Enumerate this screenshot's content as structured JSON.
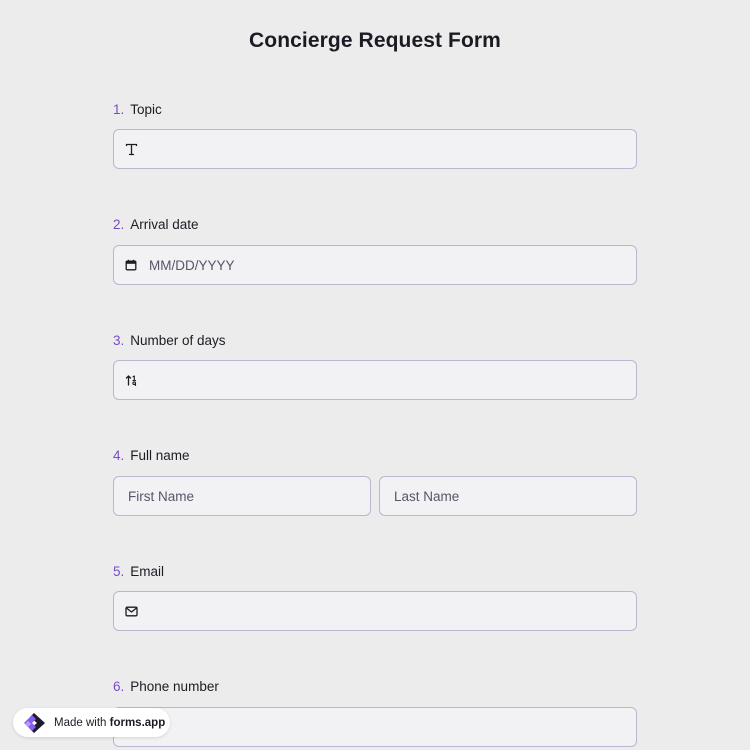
{
  "form": {
    "title": "Concierge Request Form"
  },
  "questions": [
    {
      "number": "1.",
      "label": "Topic",
      "icon": "text-icon",
      "value": "",
      "placeholder": ""
    },
    {
      "number": "2.",
      "label": "Arrival date",
      "icon": "calendar-icon",
      "value": "",
      "placeholder": "MM/DD/YYYY"
    },
    {
      "number": "3.",
      "label": "Number of days",
      "icon": "number-sort-icon",
      "value": "",
      "placeholder": ""
    },
    {
      "number": "4.",
      "label": "Full name",
      "first_placeholder": "First Name",
      "last_placeholder": "Last Name"
    },
    {
      "number": "5.",
      "label": "Email",
      "icon": "envelope-icon",
      "value": "",
      "placeholder": ""
    },
    {
      "number": "6.",
      "label": "Phone number",
      "value": "",
      "placeholder": ""
    }
  ],
  "badge": {
    "prefix": "Made with",
    "brand": "forms.app"
  },
  "colors": {
    "accent": "#7a4bc8",
    "background": "#ececed",
    "field_background": "#f2f2f4",
    "field_border": "#b7b8cf"
  }
}
